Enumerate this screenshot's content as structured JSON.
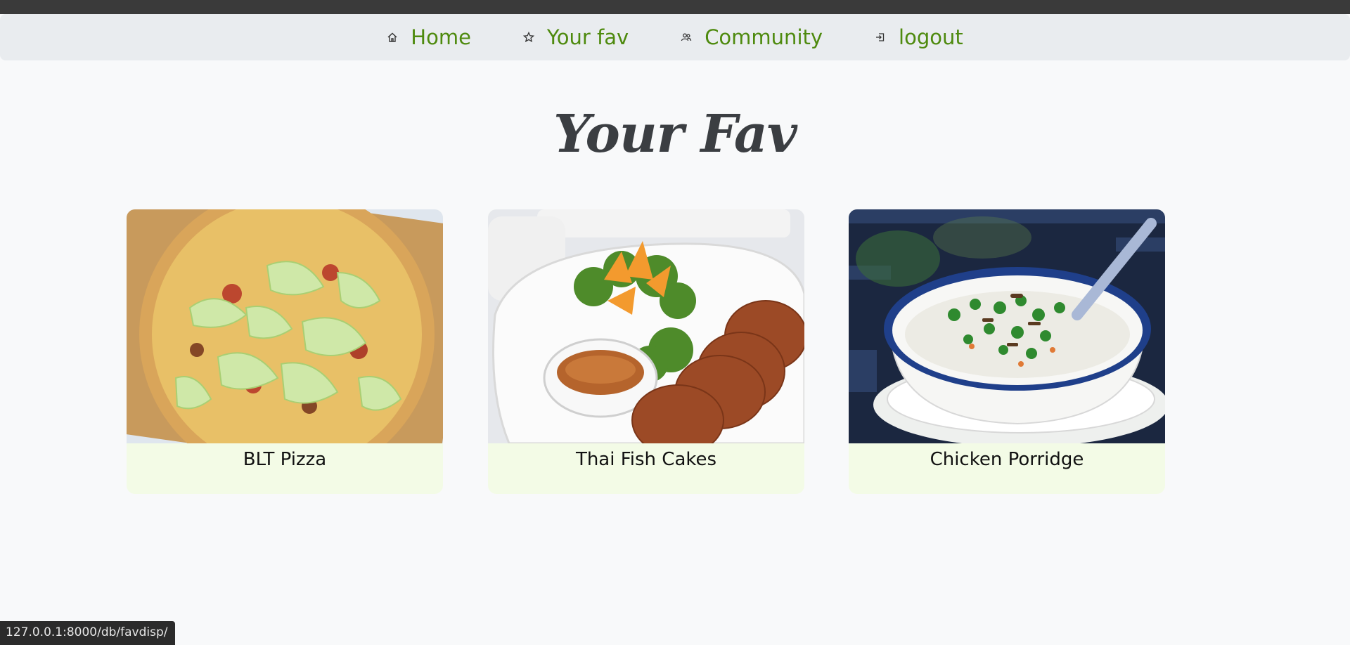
{
  "nav": {
    "items": [
      {
        "label": "Home",
        "icon": "home-icon"
      },
      {
        "label": "Your fav",
        "icon": "star-icon"
      },
      {
        "label": "Community",
        "icon": "users-icon"
      },
      {
        "label": "logout",
        "icon": "logout-icon"
      }
    ],
    "link_color": "#4e8a0e"
  },
  "page": {
    "title": "Your Fav"
  },
  "cards": [
    {
      "title": "BLT Pizza",
      "image": "pizza-photo"
    },
    {
      "title": "Thai Fish Cakes",
      "image": "fish-cakes-photo"
    },
    {
      "title": "Chicken Porridge",
      "image": "porridge-photo"
    }
  ],
  "status_bar": {
    "url": "127.0.0.1:8000/db/favdisp/"
  },
  "colors": {
    "card_bg": "#f3fbe6",
    "page_bg": "#f8f9fa",
    "nav_bg": "#e9ecef"
  }
}
